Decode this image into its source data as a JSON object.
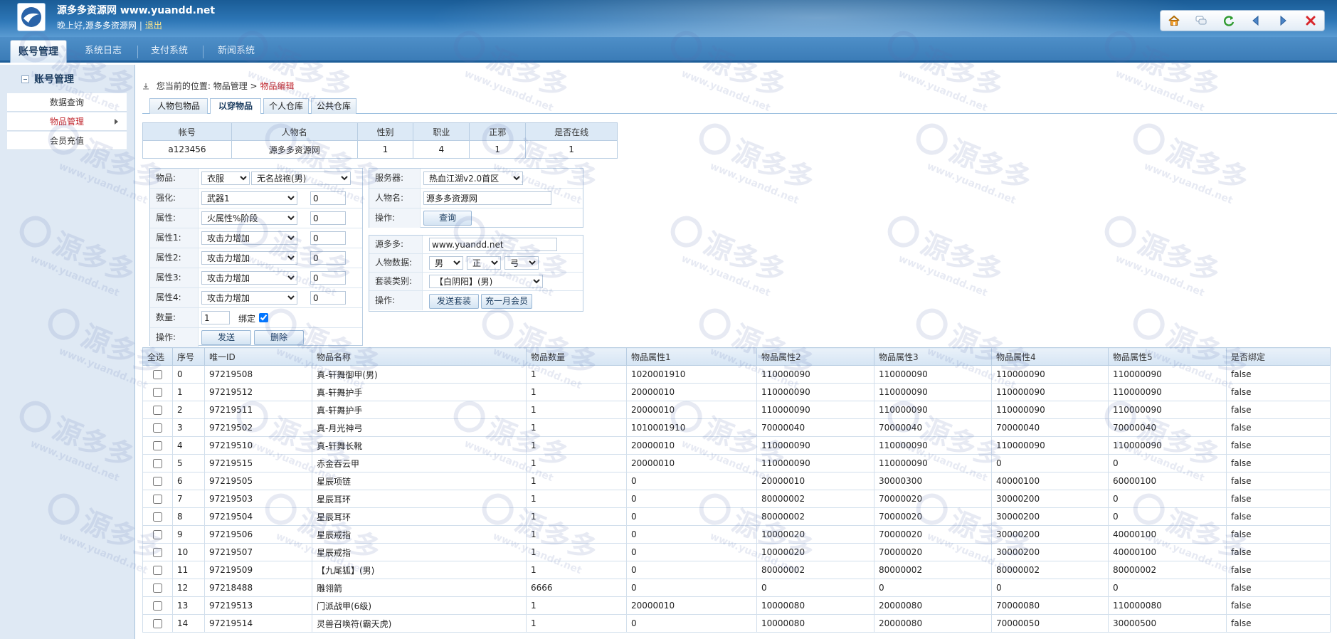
{
  "header": {
    "site_title": "源多多资源网 www.yuandd.net",
    "greeting": "晚上好,",
    "user": "源多多资源网",
    "separator": "|",
    "logout": "退出",
    "toolbar_icons": [
      "home-icon",
      "chat-icon",
      "refresh-icon",
      "back-arrow-icon",
      "forward-arrow-icon",
      "close-icon"
    ]
  },
  "nav": {
    "tabs": [
      "账号管理",
      "系统日志",
      "支付系统",
      "新闻系统"
    ]
  },
  "sidebar": {
    "title": "账号管理",
    "items": [
      "数据查询",
      "物品管理",
      "会员充值"
    ]
  },
  "breadcrumb": {
    "prefix": "您当前的位置:",
    "path": "物品管理",
    "arrow": ">",
    "current": "物品编辑"
  },
  "subtabs": [
    "人物包物品",
    "以穿物品",
    "个人仓库",
    "公共仓库"
  ],
  "account_table": {
    "headers": [
      "帐号",
      "人物名",
      "性别",
      "职业",
      "正邪",
      "是否在线"
    ],
    "row": [
      "a123456",
      "源多多资源网",
      "1",
      "4",
      "1",
      "1"
    ]
  },
  "item_form": {
    "labels": [
      "物品:",
      "强化:",
      "属性:",
      "属性1:",
      "属性2:",
      "属性3:",
      "属性4:",
      "数量:",
      "操作:"
    ],
    "item_type": "衣服",
    "item_name": "无名战袍(男)",
    "enhance": "武器1",
    "enhance_value": "0",
    "attribute": "火属性%阶段",
    "attribute_value": "0",
    "attr1": "攻击力增加",
    "attr1_value": "0",
    "attr2": "攻击力增加",
    "attr2_value": "0",
    "attr3": "攻击力增加",
    "attr3_value": "0",
    "attr4": "攻击力增加",
    "attr4_value": "0",
    "quantity": "1",
    "bind_label": "绑定",
    "send_button": "发送",
    "delete_button": "删除"
  },
  "server_form": {
    "labels": [
      "服务器:",
      "人物名:",
      "操作:"
    ],
    "server": "热血江湖v2.0首区",
    "character_name": "源多多资源网",
    "query_button": "查询"
  },
  "set_form": {
    "labels": [
      "源多多:",
      "人物数据:",
      "套装类别:",
      "操作:"
    ],
    "site_value": "www.yuandd.net",
    "gender": "男",
    "alignment": "正",
    "weapon": "弓",
    "set_type": "【白阴阳】(男)",
    "send_set_button": "发送套装",
    "vip_button": "充一月会员"
  },
  "items_table": {
    "headers": [
      "全选",
      "序号",
      "唯一ID",
      "物品名称",
      "物品数量",
      "物品属性1",
      "物品属性2",
      "物品属性3",
      "物品属性4",
      "物品属性5",
      "是否绑定"
    ],
    "rows": [
      [
        "0",
        "97219508",
        "真-轩舞御甲(男)",
        "1",
        "1020001910",
        "110000090",
        "110000090",
        "110000090",
        "110000090",
        "false"
      ],
      [
        "1",
        "97219512",
        "真-轩舞护手",
        "1",
        "20000010",
        "110000090",
        "110000090",
        "110000090",
        "110000090",
        "false"
      ],
      [
        "2",
        "97219511",
        "真-轩舞护手",
        "1",
        "20000010",
        "110000090",
        "110000090",
        "110000090",
        "110000090",
        "false"
      ],
      [
        "3",
        "97219502",
        "真-月光神弓",
        "1",
        "1010001910",
        "70000040",
        "70000040",
        "70000040",
        "70000040",
        "false"
      ],
      [
        "4",
        "97219510",
        "真-轩舞长靴",
        "1",
        "20000010",
        "110000090",
        "110000090",
        "110000090",
        "110000090",
        "false"
      ],
      [
        "5",
        "97219515",
        "赤金吞云甲",
        "1",
        "20000010",
        "110000090",
        "110000090",
        "0",
        "0",
        "false"
      ],
      [
        "6",
        "97219505",
        "星辰项链",
        "1",
        "0",
        "20000010",
        "30000300",
        "40000100",
        "60000100",
        "false"
      ],
      [
        "7",
        "97219503",
        "星辰耳环",
        "1",
        "0",
        "80000002",
        "70000020",
        "30000200",
        "0",
        "false"
      ],
      [
        "8",
        "97219504",
        "星辰耳环",
        "1",
        "0",
        "80000002",
        "70000020",
        "30000200",
        "0",
        "false"
      ],
      [
        "9",
        "97219506",
        "星辰戒指",
        "1",
        "0",
        "10000020",
        "70000020",
        "30000200",
        "40000100",
        "false"
      ],
      [
        "10",
        "97219507",
        "星辰戒指",
        "1",
        "0",
        "10000020",
        "70000020",
        "30000200",
        "40000100",
        "false"
      ],
      [
        "11",
        "97219509",
        "【九尾狐】(男)",
        "1",
        "0",
        "80000002",
        "80000002",
        "80000002",
        "80000002",
        "false"
      ],
      [
        "12",
        "97218488",
        "雕翎箭",
        "6666",
        "0",
        "0",
        "0",
        "0",
        "0",
        "false"
      ],
      [
        "13",
        "97219513",
        "门派战甲(6级)",
        "1",
        "20000010",
        "10000080",
        "20000080",
        "70000080",
        "110000080",
        "false"
      ],
      [
        "14",
        "97219514",
        "灵兽召唤符(霸天虎)",
        "1",
        "0",
        "10000080",
        "20000080",
        "70000050",
        "30000500",
        "false"
      ]
    ]
  },
  "watermark": {
    "text": "源多多",
    "url": "www.yuandd.net"
  },
  "colors": {
    "header_blue": "#2d76b6",
    "highlight_red": "#c0262d",
    "grid_border": "#b8cde2"
  }
}
